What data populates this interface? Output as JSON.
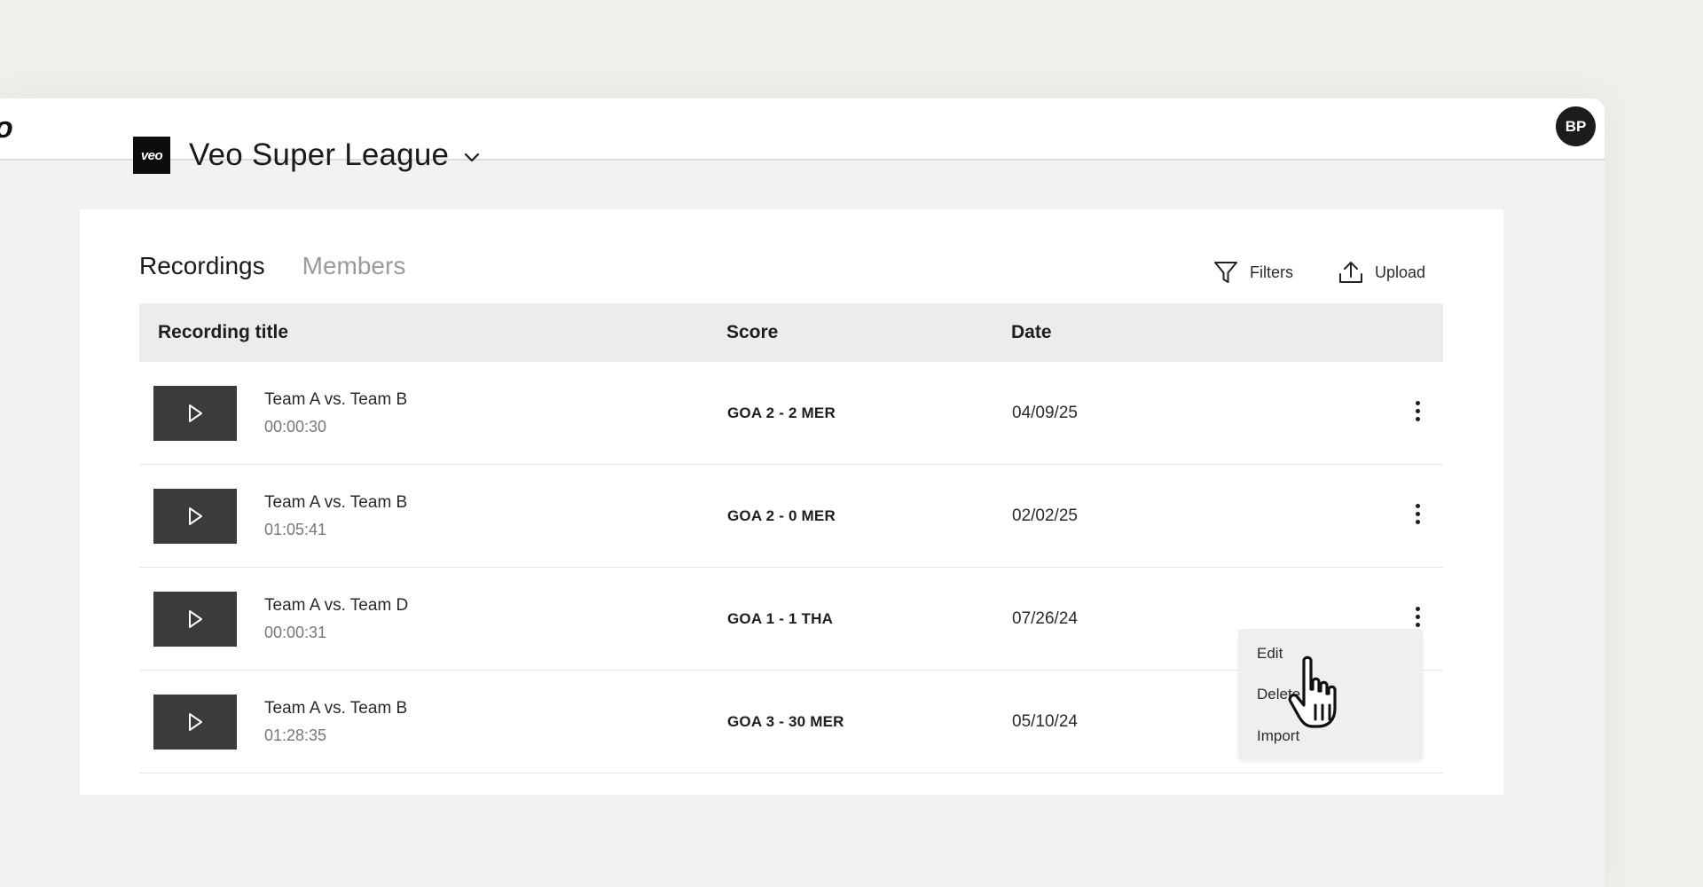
{
  "topbar": {
    "logo_fragment": "o",
    "avatar_initials": "BP"
  },
  "league": {
    "logo_text": "veo",
    "name": "Veo Super League"
  },
  "tabs": [
    {
      "label": "Recordings",
      "active": true
    },
    {
      "label": "Members",
      "active": false
    }
  ],
  "actions": {
    "filters_label": "Filters",
    "upload_label": "Upload"
  },
  "table": {
    "headers": {
      "title": "Recording title",
      "score": "Score",
      "date": "Date"
    },
    "rows": [
      {
        "title": "Team A vs. Team B",
        "duration": "00:00:30",
        "score": "GOA 2 - 2 MER",
        "date": "04/09/25"
      },
      {
        "title": "Team A vs. Team B",
        "duration": "01:05:41",
        "score": "GOA 2 - 0 MER",
        "date": "02/02/25"
      },
      {
        "title": "Team A vs. Team D",
        "duration": "00:00:31",
        "score": "GOA 1 - 1 THA",
        "date": "07/26/24"
      },
      {
        "title": "Team A vs. Team B",
        "duration": "01:28:35",
        "score": "GOA 3 - 30 MER",
        "date": "05/10/24"
      }
    ]
  },
  "context_menu": {
    "items": [
      "Edit",
      "Delete",
      "Import"
    ]
  },
  "icons": {
    "filter": "filter-icon",
    "upload": "upload-icon",
    "play": "play-icon",
    "more": "more-vertical-icon",
    "chevron": "chevron-down-icon",
    "cursor": "hand-pointer-cursor-icon"
  },
  "colors": {
    "page_bg": "#f0efeb",
    "thumb_bg": "#3b3b3b",
    "header_bg": "#ececec",
    "avatar_bg": "#1c1c1c"
  }
}
